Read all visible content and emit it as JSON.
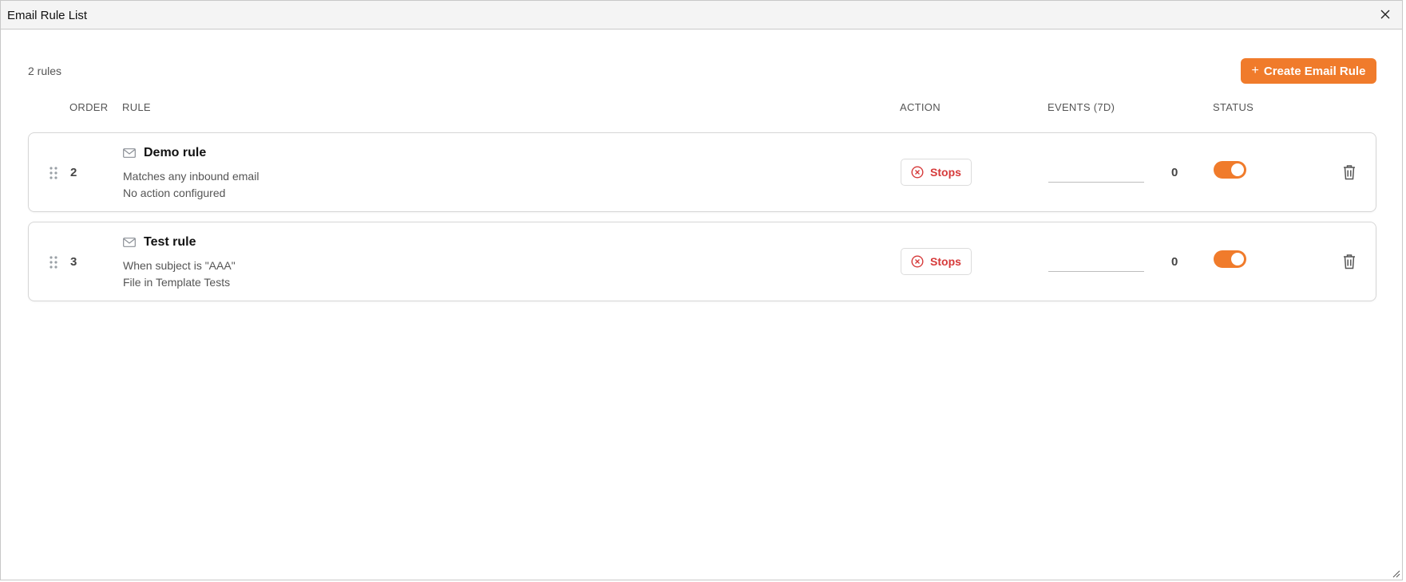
{
  "window": {
    "title": "Email Rule List"
  },
  "summary": {
    "count_text": "2 rules"
  },
  "toolbar": {
    "create_label": "Create Email Rule",
    "create_icon": "plus-icon"
  },
  "table": {
    "headers": {
      "order": "ORDER",
      "rule": "RULE",
      "action": "ACTION",
      "events": "EVENTS (7D)",
      "status": "STATUS"
    }
  },
  "rules": [
    {
      "order": "2",
      "name": "Demo rule",
      "desc1": "Matches any inbound email",
      "desc2": "No action configured",
      "action": "Stops",
      "events": "0",
      "enabled": true
    },
    {
      "order": "3",
      "name": "Test rule",
      "desc1": "When subject is \"AAA\"",
      "desc2": "File in Template Tests",
      "action": "Stops",
      "events": "0",
      "enabled": true
    }
  ],
  "colors": {
    "accent": "#f07b2b",
    "stop_red": "#d63a3a",
    "border": "#d6d6d6"
  }
}
